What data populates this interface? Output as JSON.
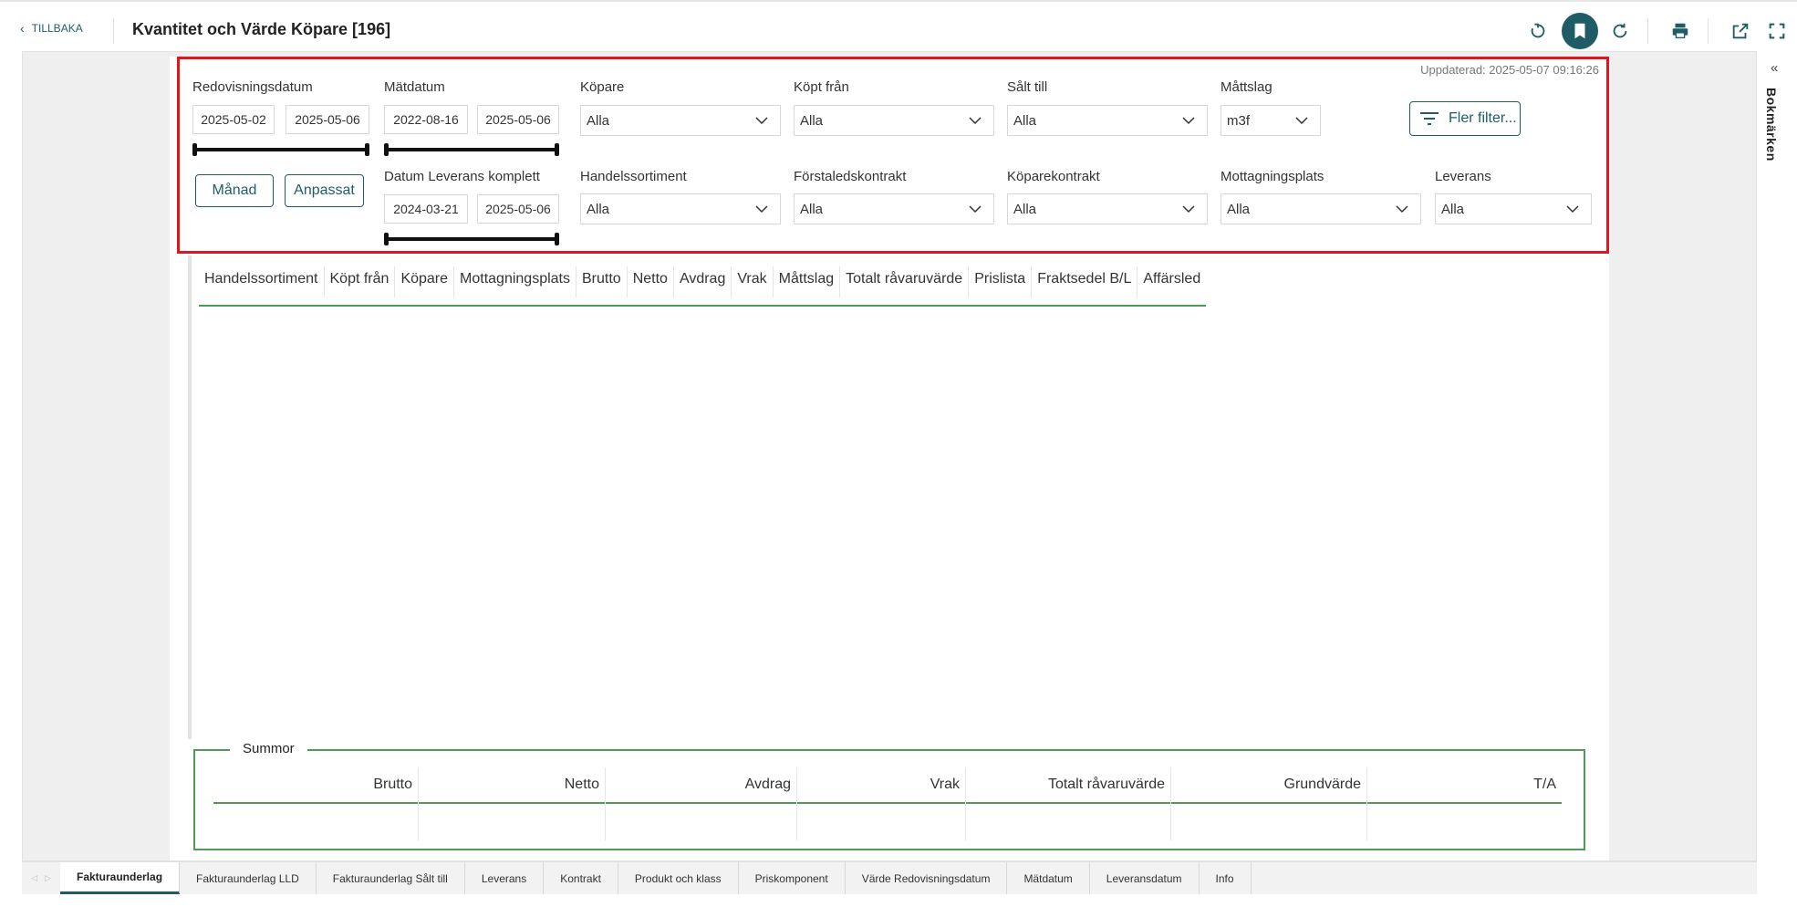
{
  "header": {
    "back_label": "TILLBAKA",
    "title": "Kvantitet och Värde Köpare [196]",
    "tools": [
      "reset-icon",
      "bookmark-icon",
      "refresh-icon",
      "print-icon",
      "open-external-icon",
      "fullscreen-icon"
    ]
  },
  "filters": {
    "updated": "Uppdaterad: 2025-05-07 09:16:26",
    "redovisningsdatum": {
      "label": "Redovisningsdatum",
      "from": "2025-05-02",
      "to": "2025-05-06"
    },
    "matdatum": {
      "label": "Mätdatum",
      "from": "2022-08-16",
      "to": "2025-05-06"
    },
    "leverans_komplett": {
      "label": "Datum Leverans komplett",
      "from": "2024-03-21",
      "to": "2025-05-06"
    },
    "manad_label": "Månad",
    "anpassat_label": "Anpassat",
    "more_filters_label": "Fler filter...",
    "dropdowns": {
      "kopare": {
        "label": "Köpare",
        "value": "Alla"
      },
      "kopt_fran": {
        "label": "Köpt från",
        "value": "Alla"
      },
      "salt_till": {
        "label": "Sålt till",
        "value": "Alla"
      },
      "mattslag": {
        "label": "Måttslag",
        "value": "m3f"
      },
      "handelssortiment": {
        "label": "Handelssortiment",
        "value": "Alla"
      },
      "forstaledskontrakt": {
        "label": "Förstaledskontrakt",
        "value": "Alla"
      },
      "koparekontrakt": {
        "label": "Köparekontrakt",
        "value": "Alla"
      },
      "mottagningsplats": {
        "label": "Mottagningsplats",
        "value": "Alla"
      },
      "leverans": {
        "label": "Leverans",
        "value": "Alla"
      }
    }
  },
  "table": {
    "columns": [
      "Handelssortiment",
      "Köpt från",
      "Köpare",
      "Mottagningsplats",
      "Brutto",
      "Netto",
      "Avdrag",
      "Vrak",
      "Måttslag",
      "Totalt råvaruvärde",
      "Prislista",
      "Fraktsedel B/L",
      "Affärsled"
    ]
  },
  "summor": {
    "title": "Summor",
    "columns": [
      "Brutto",
      "Netto",
      "Avdrag",
      "Vrak",
      "Totalt råvaruvärde",
      "Grundvärde",
      "T/A"
    ]
  },
  "sidebar": {
    "label": "Bokmärken"
  },
  "tabs": {
    "items": [
      "Fakturaunderlag",
      "Fakturaunderlag LLD",
      "Fakturaunderlag Sålt till",
      "Leverans",
      "Kontrakt",
      "Produkt och klass",
      "Priskomponent",
      "Värde Redovisningsdatum",
      "Mätdatum",
      "Leveransdatum",
      "Info"
    ],
    "active": "Fakturaunderlag"
  }
}
